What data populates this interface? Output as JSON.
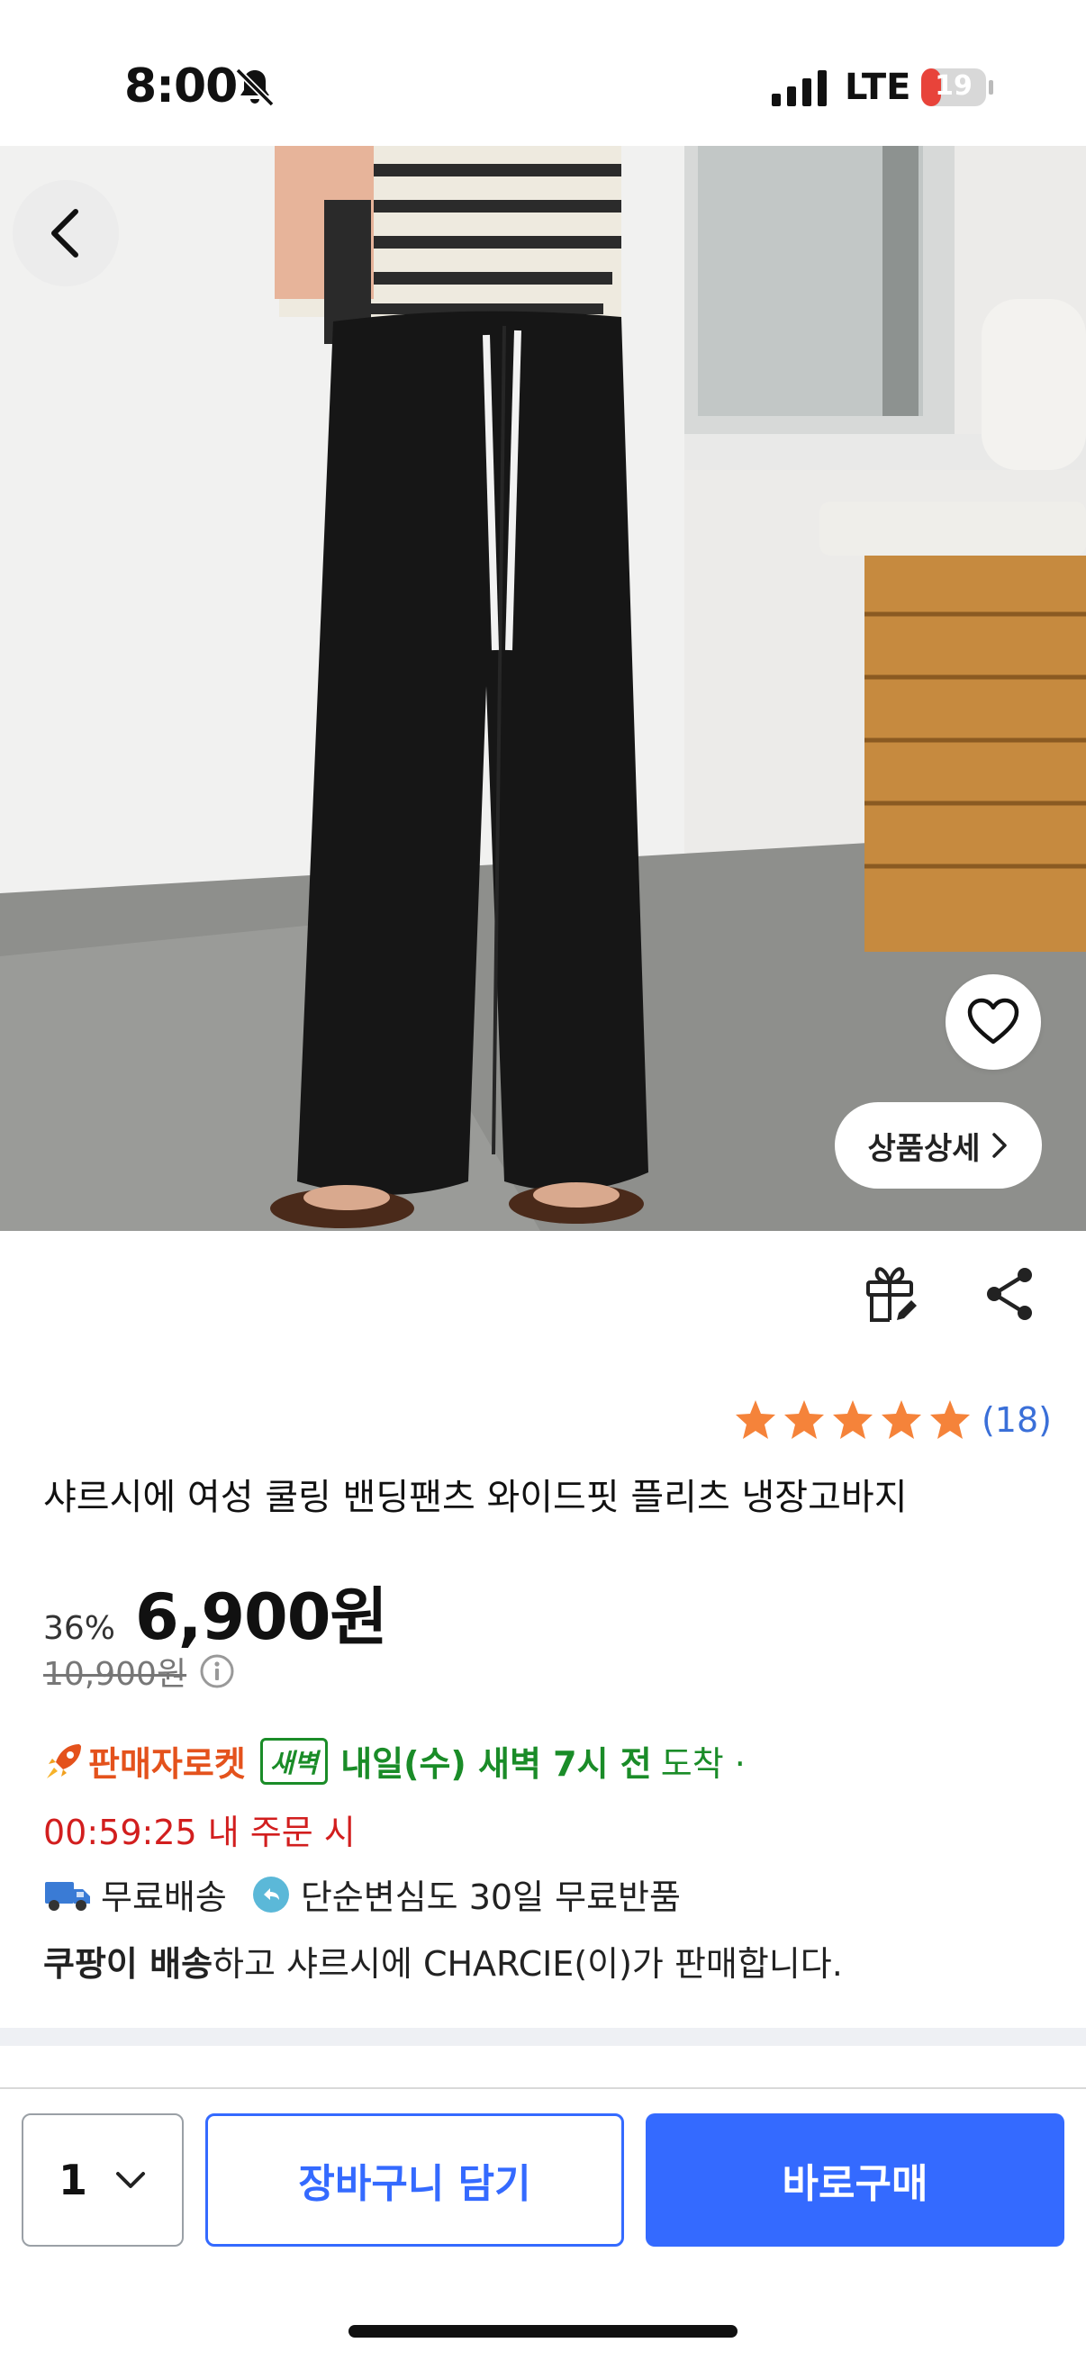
{
  "status_bar": {
    "time": "8:00",
    "network": "LTE",
    "battery": "19"
  },
  "hero": {
    "detail_label": "상품상세",
    "icons": [
      "chevron-left-icon",
      "heart-icon",
      "chevron-right-icon"
    ]
  },
  "actions": {
    "icons": [
      "gift-icon",
      "share-icon"
    ]
  },
  "product": {
    "rating_stars": 5,
    "review_count": "(18)",
    "title": "샤르시에 여성 쿨링 밴딩팬츠 와이드핏 플리츠 냉장고바지",
    "discount": "36%",
    "price": "6,900원",
    "original_price": "10,900원"
  },
  "delivery": {
    "label": "판매자로켓",
    "badge": "새벽",
    "arrival_bold": "내일(수) 새벽 7시 전",
    "arrival_normal": "도착 ·",
    "countdown": "00:59:25 내 주문 시",
    "free_shipping": "무료배송",
    "free_return": "단순변심도 30일 무료반품",
    "seller_bold": "쿠팡이 배송",
    "seller_rest": "하고 샤르시에 CHARCIE(이)가 판매합니다."
  },
  "bottom_bar": {
    "quantity": "1",
    "cart_label": "장바구니 담기",
    "buy_label": "바로구매"
  },
  "colors": {
    "primary_blue": "#346aff",
    "star_orange": "#f5833a",
    "rocket_orange": "#e4521c",
    "dawn_green": "#1a8c28",
    "countdown_red": "#d21e1e",
    "battery_red": "#e8433a"
  }
}
